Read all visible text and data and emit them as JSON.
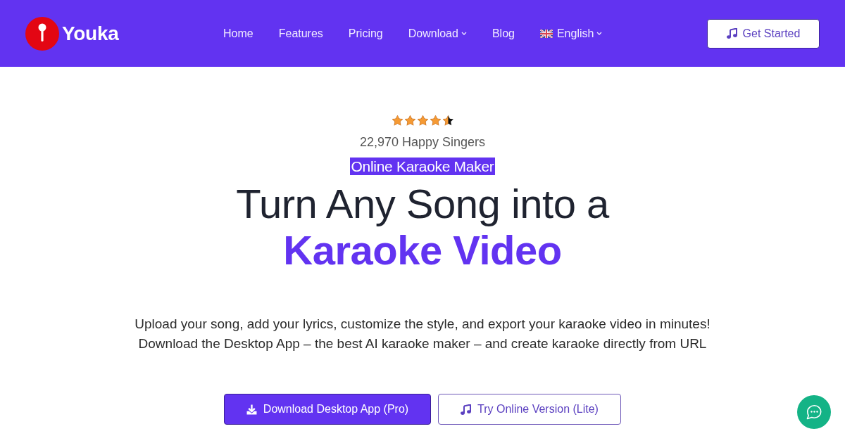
{
  "navbar": {
    "brand": "Youka",
    "links": [
      {
        "label": "Home",
        "kind": "link"
      },
      {
        "label": "Features",
        "kind": "link"
      },
      {
        "label": "Pricing",
        "kind": "link"
      },
      {
        "label": "Download",
        "kind": "dropdown"
      },
      {
        "label": "Blog",
        "kind": "link"
      },
      {
        "label": "English",
        "kind": "language"
      }
    ],
    "cta": "Get Started"
  },
  "hero": {
    "rating": {
      "stars": 4.5,
      "caption": "22,970 Happy Singers"
    },
    "tag": "Online Karaoke Maker",
    "headline": "Turn Any Song into a",
    "headline_accent": "Karaoke Video",
    "description": [
      "Upload your song, add your lyrics, customize the style, and export your karaoke video in minutes!",
      "Download the Desktop App – the best AI karaoke maker – and create karaoke directly from URL"
    ],
    "buttons": [
      {
        "label": "Download Desktop App (Pro)",
        "kind": "primary"
      },
      {
        "label": "Try Online Version (Lite)",
        "kind": "outline"
      }
    ]
  }
}
